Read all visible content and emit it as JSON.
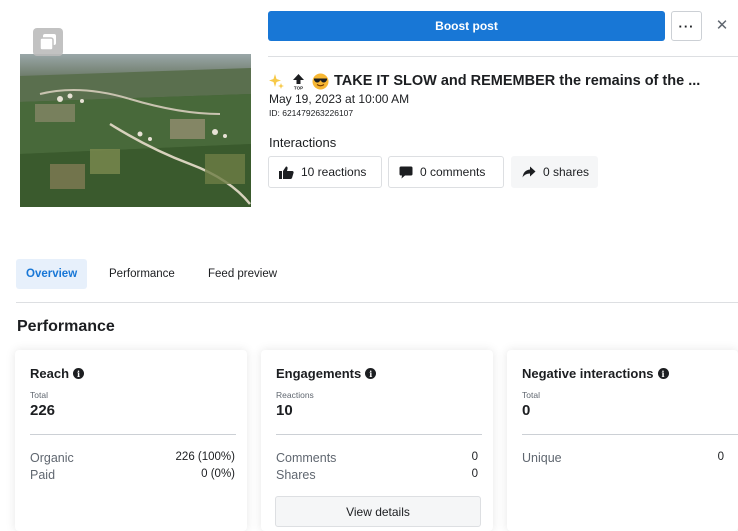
{
  "post": {
    "boost_label": "Boost post",
    "more_label": "···",
    "close_label": "✕",
    "title": "TAKE IT SLOW and REMEMBER the remains of the ...",
    "date": "May 19, 2023 at 10:00 AM",
    "id": "ID: 621479263226107",
    "title_icons": [
      "sparkles-emoji",
      "top-arrow-emoji",
      "sunglasses-emoji"
    ]
  },
  "interactions": {
    "label": "Interactions",
    "reactions": "10 reactions",
    "comments": "0 comments",
    "shares": "0 shares"
  },
  "tabs": [
    {
      "label": "Overview",
      "active": true
    },
    {
      "label": "Performance",
      "active": false
    },
    {
      "label": "Feed preview",
      "active": false
    }
  ],
  "performance": {
    "title": "Performance",
    "reach": {
      "title": "Reach",
      "sub": "Total",
      "value": "226",
      "rows": [
        {
          "label": "Organic",
          "value": "226 (100%)"
        },
        {
          "label": "Paid",
          "value": "0 (0%)"
        }
      ]
    },
    "engagements": {
      "title": "Engagements",
      "sub": "Reactions",
      "value": "10",
      "rows": [
        {
          "label": "Comments",
          "value": "0"
        },
        {
          "label": "Shares",
          "value": "0"
        }
      ],
      "button": "View details"
    },
    "negative": {
      "title": "Negative interactions",
      "sub": "Total",
      "value": "0",
      "rows": [
        {
          "label": "Unique",
          "value": "0"
        }
      ]
    }
  },
  "colors": {
    "accent": "#1877d6",
    "active_tab_bg": "#e7f0fb",
    "text": "#1c1e21",
    "muted": "#606770"
  }
}
